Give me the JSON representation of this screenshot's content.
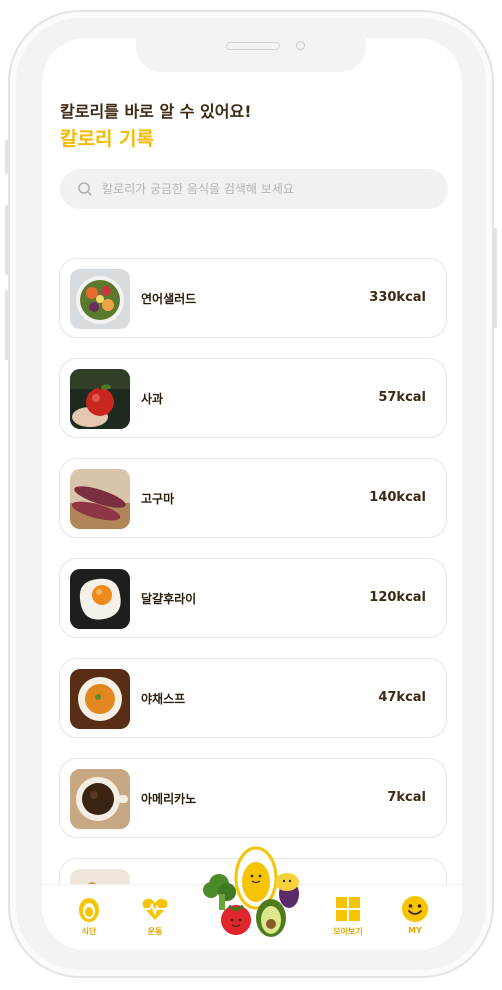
{
  "header": {
    "subtitle": "칼로리를 바로 알 수 있어요!",
    "title": "칼로리 기록"
  },
  "search": {
    "placeholder": "칼로리가 궁금한 음식을 검색해 보세요",
    "icon": "search-icon"
  },
  "foods": [
    {
      "name": "연어샐러드",
      "kcal": "330kcal",
      "icon": "salad-photo"
    },
    {
      "name": "사과",
      "kcal": "57kcal",
      "icon": "apple-photo"
    },
    {
      "name": "고구마",
      "kcal": "140kcal",
      "icon": "sweet-potato-photo"
    },
    {
      "name": "달걀후라이",
      "kcal": "120kcal",
      "icon": "fried-egg-photo"
    },
    {
      "name": "야채스프",
      "kcal": "47kcal",
      "icon": "vegetable-soup-photo"
    },
    {
      "name": "아메리카노",
      "kcal": "7kcal",
      "icon": "americano-photo"
    }
  ],
  "nav": {
    "diet": "식단",
    "exercise": "운동",
    "overview": "모아보기",
    "my": "MY"
  },
  "colors": {
    "accent": "#f6b800",
    "text_dark": "#3c2a12",
    "card_border": "#e4e4e4",
    "search_bg": "#f1f1f1"
  }
}
